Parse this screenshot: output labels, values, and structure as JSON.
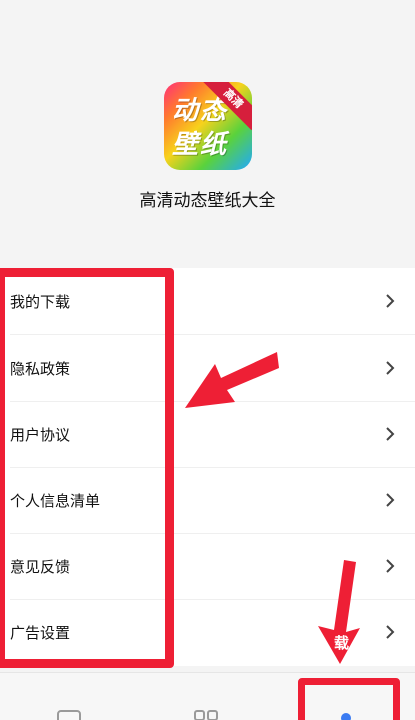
{
  "app": {
    "name": "高清动态壁纸大全",
    "icon_badge": "高清",
    "icon_text": "动态壁纸"
  },
  "menu": {
    "items": [
      {
        "label": "我的下载"
      },
      {
        "label": "隐私政策"
      },
      {
        "label": "用户协议"
      },
      {
        "label": "个人信息清单"
      },
      {
        "label": "意见反馈"
      },
      {
        "label": "广告设置"
      }
    ]
  },
  "overlay": {
    "partial_text": "载"
  },
  "colors": {
    "annotation": "#ee1f35",
    "page_bg": "#f4f4f4",
    "menu_bg": "#ffffff",
    "active_tab": "#3a7bf2"
  },
  "icons": {
    "menu_chevron": "chevron-right-icon",
    "tab_home": "home-icon",
    "tab_category": "grid-icon",
    "tab_mine": "profile-icon"
  }
}
